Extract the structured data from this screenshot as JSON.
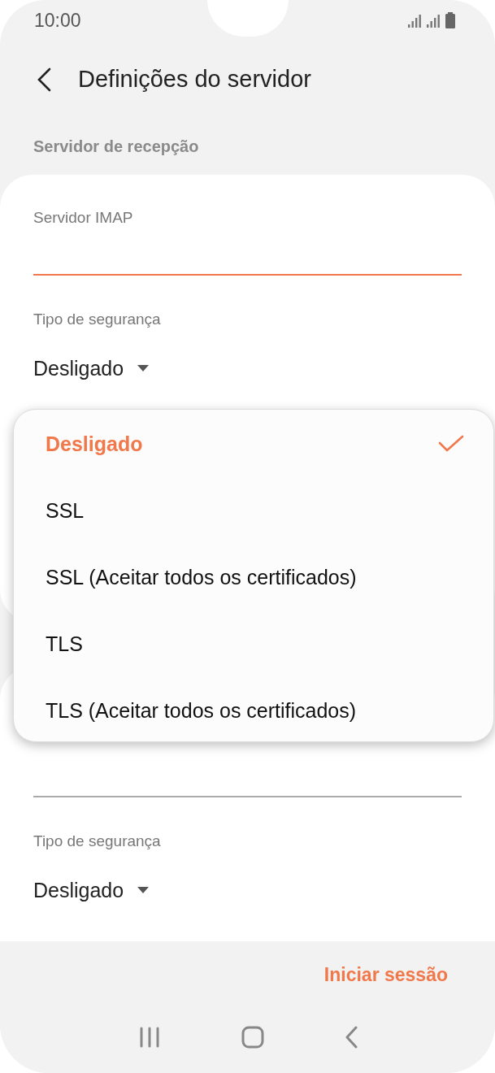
{
  "status_bar": {
    "time": "10:00"
  },
  "header": {
    "title": "Definições do servidor"
  },
  "section": {
    "title": "Servidor de recepção"
  },
  "cards": [
    {
      "fields": [
        {
          "kind": "input",
          "label": "Servidor IMAP",
          "focused": true
        },
        {
          "kind": "dropdown",
          "label": "Tipo de segurança",
          "value": "Desligado"
        }
      ]
    },
    {
      "fields": [
        {
          "kind": "input",
          "focused": false
        },
        {
          "kind": "dropdown",
          "label": "Tipo de segurança",
          "value": "Desligado"
        }
      ]
    }
  ],
  "popup": {
    "options": [
      {
        "label": "Desligado",
        "selected": true
      },
      {
        "label": "SSL",
        "selected": false
      },
      {
        "label": "SSL (Aceitar todos os certificados)",
        "selected": false
      },
      {
        "label": "TLS",
        "selected": false
      },
      {
        "label": "TLS (Aceitar todos os certificados)",
        "selected": false
      }
    ]
  },
  "action": {
    "label": "Iniciar sessão"
  }
}
